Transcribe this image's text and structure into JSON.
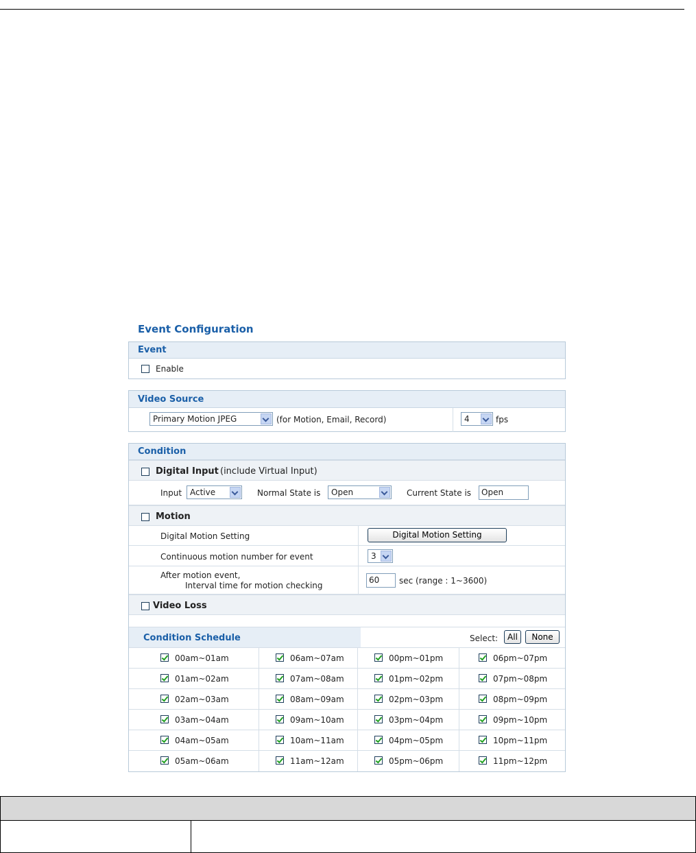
{
  "page_title": "Event Configuration",
  "event": {
    "header": "Event",
    "enable_label": "Enable",
    "enable_checked": false
  },
  "video_source": {
    "header": "Video Source",
    "source_value": "Primary Motion JPEG",
    "source_note": "(for Motion, Email, Record)",
    "fps_value": "4",
    "fps_unit": "fps"
  },
  "condition": {
    "header": "Condition",
    "digital_input": {
      "label": "Digital Input",
      "note": "(include Virtual Input)",
      "checked": false,
      "input_label": "Input",
      "input_value": "Active",
      "normal_state_label": "Normal State is",
      "normal_state_value": "Open",
      "current_state_label": "Current State is",
      "current_state_value": "Open"
    },
    "motion": {
      "label": "Motion",
      "checked": false,
      "setting_label": "Digital Motion Setting",
      "setting_button": "Digital Motion Setting",
      "continuous_label": "Continuous motion number for event",
      "continuous_value": "3",
      "after_label_1": "After motion event,",
      "after_label_2": "Interval time for motion checking",
      "interval_value": "60",
      "interval_note": "sec (range : 1~3600)"
    },
    "video_loss": {
      "label": "Video Loss",
      "checked": false
    }
  },
  "schedule": {
    "header": "Condition Schedule",
    "select_label": "Select:",
    "all_button": "All",
    "none_button": "None",
    "columns": [
      [
        "00am~01am",
        "01am~02am",
        "02am~03am",
        "03am~04am",
        "04am~05am",
        "05am~06am"
      ],
      [
        "06am~07am",
        "07am~08am",
        "08am~09am",
        "09am~10am",
        "10am~11am",
        "11am~12am"
      ],
      [
        "00pm~01pm",
        "01pm~02pm",
        "02pm~03pm",
        "03pm~04pm",
        "04pm~05pm",
        "05pm~06pm"
      ],
      [
        "06pm~07pm",
        "07pm~08pm",
        "08pm~09pm",
        "09pm~10pm",
        "10pm~11pm",
        "11pm~12pm"
      ]
    ],
    "all_checked": true
  },
  "colors": {
    "accent": "#1a5fa8",
    "header_bg": "#e6eef6",
    "check_green": "#21a021"
  }
}
